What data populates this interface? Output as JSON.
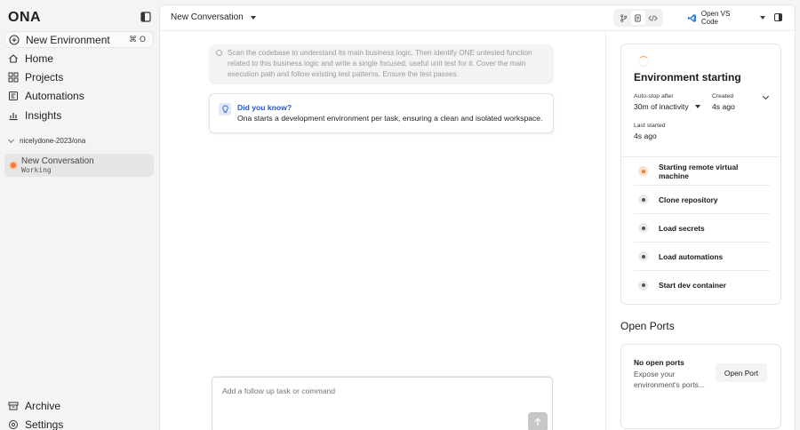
{
  "sidebar": {
    "logo": "ONA",
    "new_environment": {
      "label": "New Environment",
      "shortcut": "⌘ O"
    },
    "nav": [
      {
        "label": "Home",
        "icon": "home-icon"
      },
      {
        "label": "Projects",
        "icon": "grid-icon"
      },
      {
        "label": "Automations",
        "icon": "automation-icon"
      },
      {
        "label": "Insights",
        "icon": "insights-icon"
      }
    ],
    "repo": "nicelydone-2023/ona",
    "conversation": {
      "title": "New Conversation",
      "status": "Working"
    },
    "bottom": [
      {
        "label": "Archive",
        "icon": "archive-icon"
      },
      {
        "label": "Settings",
        "icon": "settings-icon"
      }
    ]
  },
  "topbar": {
    "conversation_title": "New Conversation",
    "open_vscode": "Open VS Code"
  },
  "conversation": {
    "prompt": "Scan the codebase to understand its main business logic. Then identify ONE untested function related to this business logic and write a single focused, useful unit test for it. Cover the main execution path and follow existing test patterns. Ensure the test passes.",
    "tip_title": "Did you know?",
    "tip_text": "Ona starts a development environment per task, ensuring a clean and isolated workspace.",
    "input_placeholder": "Add a follow up task or command"
  },
  "environment": {
    "title": "Environment starting",
    "auto_stop_label": "Auto-stop after",
    "auto_stop_value": "30m of inactivity",
    "created_label": "Created",
    "created_value": "4s ago",
    "last_started_label": "Last started",
    "last_started_value": "4s ago",
    "steps": [
      {
        "label": "Starting remote virtual machine",
        "active": true
      },
      {
        "label": "Clone repository",
        "active": false
      },
      {
        "label": "Load secrets",
        "active": false
      },
      {
        "label": "Load automations",
        "active": false
      },
      {
        "label": "Start dev container",
        "active": false
      }
    ]
  },
  "ports": {
    "title": "Open Ports",
    "none_label": "No open ports",
    "description": "Expose your environment's ports...",
    "button": "Open Port"
  },
  "colors": {
    "accent_orange": "#f07a3c",
    "link_blue": "#2a56c6",
    "vscode_blue": "#2f7fd6"
  }
}
